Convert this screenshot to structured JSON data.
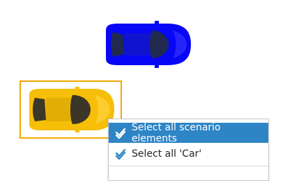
{
  "canvas": {
    "cars": [
      {
        "name": "blue car",
        "body_color": "#0707f5",
        "glass_color": "#20294e"
      },
      {
        "name": "yellow car",
        "body_color": "#f6be06",
        "glass_color": "#3c3628"
      }
    ],
    "selection_color": "#f0a800"
  },
  "context_menu": {
    "items": [
      {
        "label": "Select all scenario elements",
        "icon": "check-list-icon",
        "highlighted": true
      },
      {
        "label": "Select all 'Car'",
        "icon": "check-list-icon",
        "highlighted": false
      }
    ],
    "highlight_color": "#2e85c6"
  }
}
